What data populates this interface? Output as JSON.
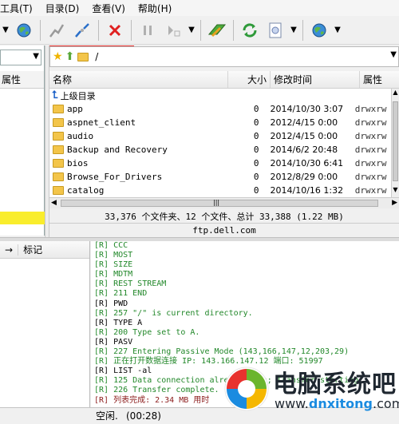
{
  "menu": [
    "工具(T)",
    "目录(D)",
    "查看(V)",
    "帮助(H)"
  ],
  "path": "/",
  "left_header": "属性",
  "columns": {
    "name": "名称",
    "size": "大小",
    "date": "修改时间",
    "attr": "属性"
  },
  "parent_dir": "上级目录",
  "files": [
    {
      "name": "app",
      "size": "0",
      "date": "2014/10/30 3:07",
      "attr": "drwxrw"
    },
    {
      "name": "aspnet_client",
      "size": "0",
      "date": "2012/4/15 0:00",
      "attr": "drwxrw"
    },
    {
      "name": "audio",
      "size": "0",
      "date": "2012/4/15 0:00",
      "attr": "drwxrw"
    },
    {
      "name": "Backup and Recovery",
      "size": "0",
      "date": "2014/6/2 20:48",
      "attr": "drwxrw"
    },
    {
      "name": "bios",
      "size": "0",
      "date": "2014/10/30 6:41",
      "attr": "drwxrw"
    },
    {
      "name": "Browse_For_Drivers",
      "size": "0",
      "date": "2012/8/29 0:00",
      "attr": "drwxrw"
    },
    {
      "name": "catalog",
      "size": "0",
      "date": "2014/10/16 1:32",
      "attr": "drwxrw"
    }
  ],
  "summary": "33,376 个文件夹、12 个文件、总计 33,388 (1.22 MB)",
  "host": "ftp.dell.com",
  "queue_header": [
    "→",
    "标记"
  ],
  "log": [
    {
      "text": "[R]  CCC",
      "c": "green"
    },
    {
      "text": "[R]  MOST",
      "c": "green"
    },
    {
      "text": "[R]  SIZE",
      "c": "green"
    },
    {
      "text": "[R]  MDTM",
      "c": "green"
    },
    {
      "text": "[R]  REST STREAM",
      "c": "green"
    },
    {
      "text": "[R] 211 END",
      "c": "green"
    },
    {
      "text": "[R] PWD",
      "c": "black"
    },
    {
      "text": "[R] 257 \"/\" is current directory.",
      "c": "green"
    },
    {
      "text": "[R] TYPE A",
      "c": "black"
    },
    {
      "text": "[R] 200 Type set to A.",
      "c": "green"
    },
    {
      "text": "[R] PASV",
      "c": "black"
    },
    {
      "text": "[R] 227 Entering Passive Mode (143,166,147,12,203,29)",
      "c": "green"
    },
    {
      "text": "[R] 正在打开数据连接 IP: 143.166.147.12 端口: 51997",
      "c": "green"
    },
    {
      "text": "[R] LIST -al",
      "c": "black"
    },
    {
      "text": "[R] 125 Data connection already open; Transfer starting.",
      "c": "green"
    },
    {
      "text": "[R] 226 Transfer complete.",
      "c": "green"
    },
    {
      "text": "[R] 列表完成: 2.34 MB 用时",
      "c": "maroon"
    }
  ],
  "status_idle": "空闲.",
  "status_time": "(00:28)",
  "watermark": {
    "text": "电脑系统吧",
    "url_prefix": "www.",
    "url_brand": "dnxitong",
    "url_suffix": ".com"
  },
  "colors": {
    "accent_red": "#e8322e",
    "log_green": "#22882a",
    "highlight_yellow": "#f9ed2c"
  }
}
